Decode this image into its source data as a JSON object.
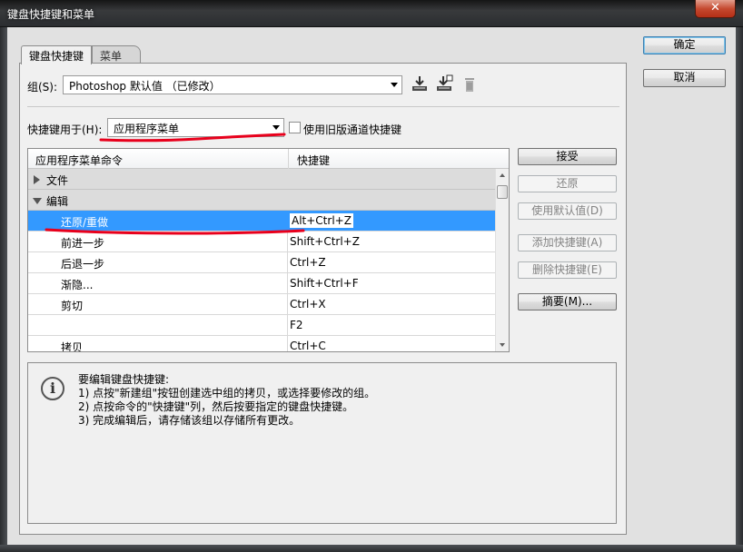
{
  "window": {
    "title": "键盘快捷键和菜单",
    "close_glyph": "✕"
  },
  "tabs": [
    {
      "label": "键盘快捷键",
      "active": true
    },
    {
      "label": "菜单",
      "active": false
    }
  ],
  "set": {
    "label": "组(S):",
    "value": "Photoshop 默认值 （已修改）",
    "icons": [
      "save-set-icon",
      "save-as-set-icon",
      "delete-set-icon"
    ]
  },
  "shortcuts_for": {
    "label": "快捷键用于(H):",
    "value": "应用程序菜单",
    "legacy_checkbox_label": "使用旧版通道快捷键",
    "legacy_checked": false
  },
  "table": {
    "col_command": "应用程序菜单命令",
    "col_shortcut": "快捷键",
    "rows": [
      {
        "command": "文件",
        "shortcut": "",
        "type": "group",
        "expanded": false
      },
      {
        "command": "编辑",
        "shortcut": "",
        "type": "group",
        "expanded": true
      },
      {
        "command": "还原/重做",
        "shortcut": "Alt+Ctrl+Z",
        "type": "item",
        "selected": true
      },
      {
        "command": "前进一步",
        "shortcut": "Shift+Ctrl+Z",
        "type": "item"
      },
      {
        "command": "后退一步",
        "shortcut": "Ctrl+Z",
        "type": "item"
      },
      {
        "command": "渐隐...",
        "shortcut": "Shift+Ctrl+F",
        "type": "item"
      },
      {
        "command": "剪切",
        "shortcut": "Ctrl+X",
        "type": "item"
      },
      {
        "command": "",
        "shortcut": "F2",
        "type": "item"
      },
      {
        "command": "拷贝",
        "shortcut": "Ctrl+C",
        "type": "item"
      }
    ]
  },
  "side_buttons": {
    "accept": "接受",
    "undo": "还原",
    "use_default": "使用默认值(D)",
    "add_shortcut": "添加快捷键(A)",
    "delete_shortcut": "删除快捷键(E)",
    "summary": "摘要(M)..."
  },
  "dialog_buttons": {
    "ok": "确定",
    "cancel": "取消"
  },
  "info": {
    "icon_glyph": "i",
    "line1": "要编辑键盘快捷键:",
    "line2": "1) 点按\"新建组\"按钮创建选中组的拷贝，或选择要修改的组。",
    "line3": "2) 点按命令的\"快捷键\"列，然后按要指定的键盘快捷键。",
    "line4": "3) 完成编辑后，请存储该组以存储所有更改。"
  },
  "colors": {
    "selection": "#3399ff",
    "annotation_red": "#e8001c"
  }
}
